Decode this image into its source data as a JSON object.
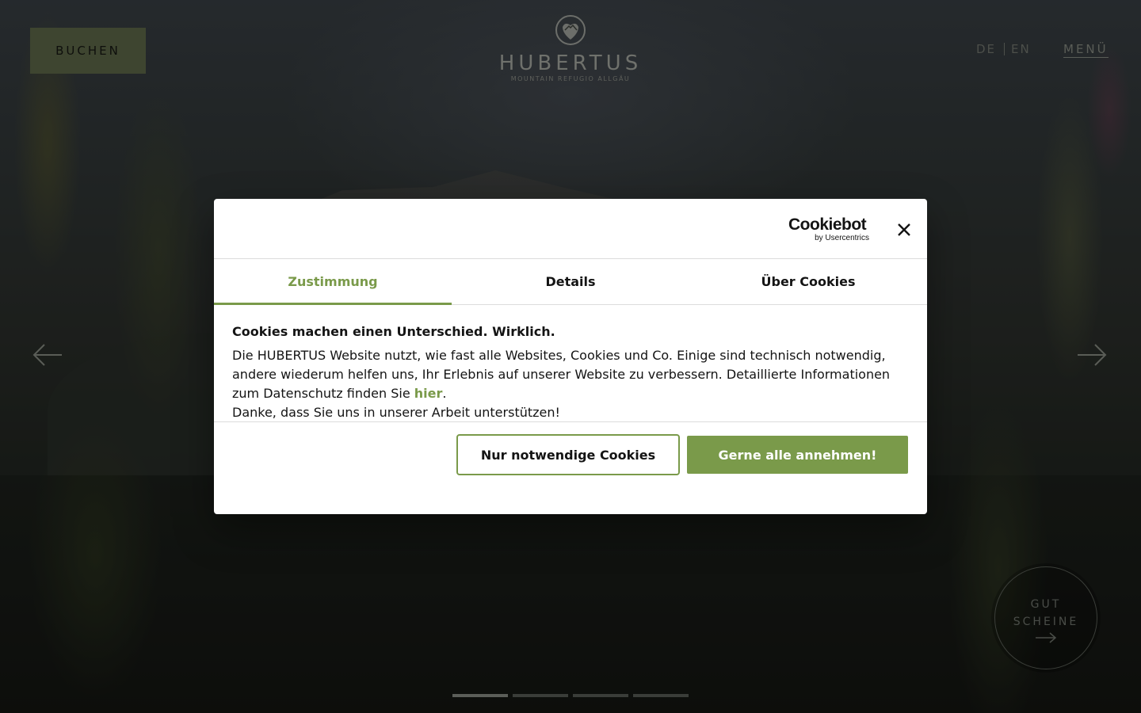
{
  "header": {
    "book_label": "BUCHEN",
    "logo_name": "HUBERTUS",
    "logo_sub": "MOUNTAIN REFUGIO ALLGÄU",
    "lang_de": "DE",
    "lang_en": "EN",
    "menu_label": "MENÜ"
  },
  "voucher": {
    "line1": "GUT",
    "line2": "SCHEINE"
  },
  "slider": {
    "slide_count": 4,
    "active_slide": 1
  },
  "cookie_dialog": {
    "brand_main": "Cookiebot",
    "brand_sub": "by Usercentrics",
    "tabs": [
      {
        "label": "Zustimmung",
        "active": true
      },
      {
        "label": "Details",
        "active": false
      },
      {
        "label": "Über Cookies",
        "active": false
      }
    ],
    "heading": "Cookies machen einen Unterschied. Wirklich.",
    "text_part1": "Die HUBERTUS Website nutzt, wie fast alle Websites, Cookies und Co. Einige sind technisch notwendig, andere wiederum helfen uns, Ihr Erlebnis auf unserer Website zu verbessern. Detaillierte Informationen zum Datenschutz finden Sie ",
    "link_text": "hier",
    "text_part2": ".",
    "text_line2": "Danke, dass Sie uns in unserer Arbeit unterstützen!",
    "btn_necessary": "Nur notwendige Cookies",
    "btn_accept_all": "Gerne alle annehmen!"
  },
  "colors": {
    "accent": "#7a9a4a",
    "book_button_bg": "#3e4530",
    "dialog_bg": "#ffffff"
  }
}
